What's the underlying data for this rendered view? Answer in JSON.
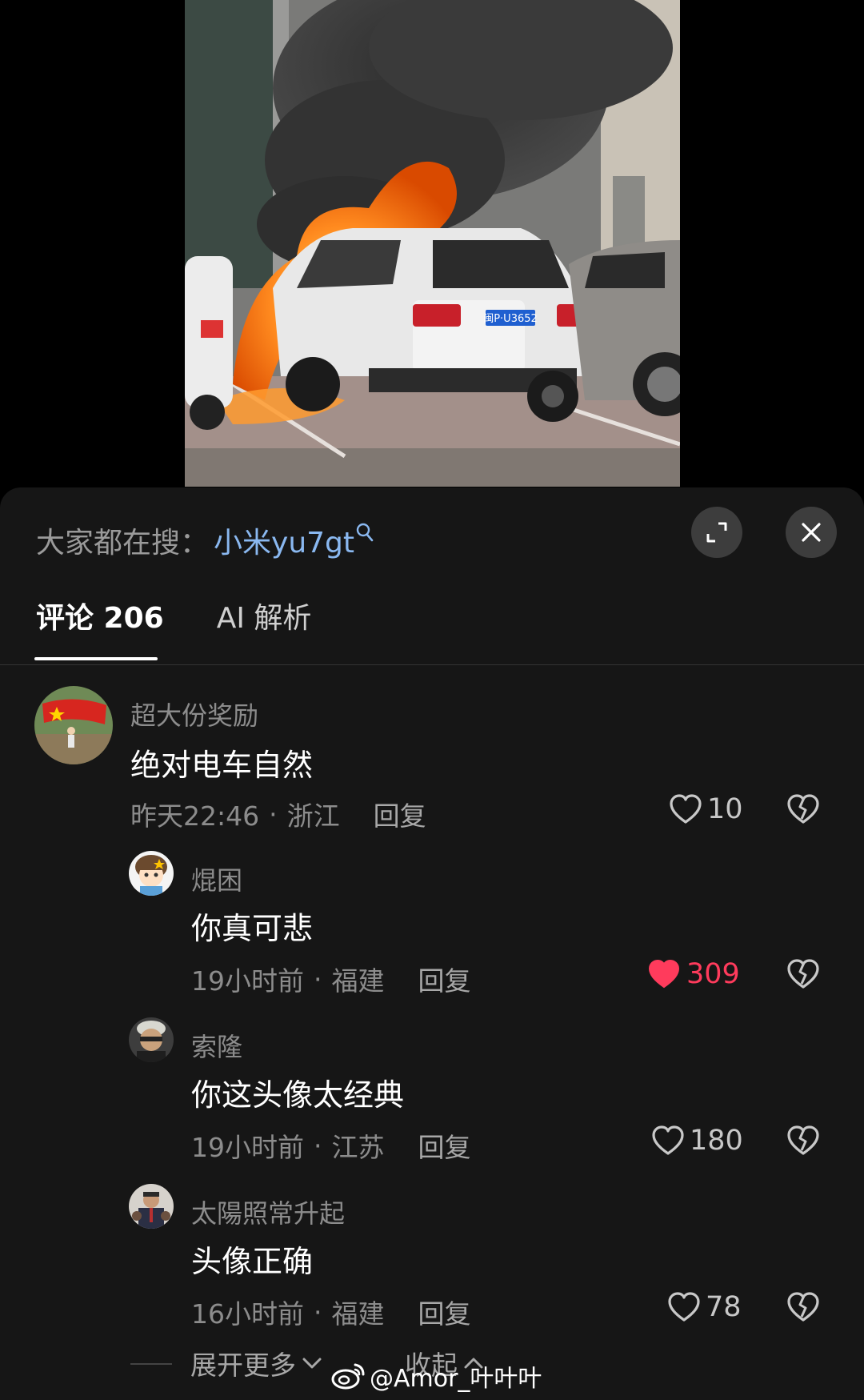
{
  "search": {
    "prefix": "大家都在搜：",
    "term": "小米yu7gt",
    "icon": "search-icon"
  },
  "tabs": [
    {
      "label": "评论 206",
      "active": true
    },
    {
      "label": "AI 解析",
      "active": false
    }
  ],
  "video": {
    "plate": "闽P·U3652"
  },
  "comments": [
    {
      "name": "超大份奖励",
      "text": "绝对电车自然",
      "time": "昨天22:46",
      "location": "浙江",
      "reply": "回复",
      "likes": "10",
      "liked": false
    },
    {
      "name": "焜困",
      "text": "你真可悲",
      "time": "19小时前",
      "location": "福建",
      "reply": "回复",
      "likes": "309",
      "liked": true
    },
    {
      "name": "索隆",
      "text": "你这头像太经典",
      "time": "19小时前",
      "location": "江苏",
      "reply": "回复",
      "likes": "180",
      "liked": false
    },
    {
      "name": "太陽照常升起",
      "text": "头像正确",
      "time": "16小时前",
      "location": "福建",
      "reply": "回复",
      "likes": "78",
      "liked": false
    }
  ],
  "footer": {
    "expand_more": "展开更多",
    "collapse": "收起",
    "watermark": "@Amor_叶叶叶"
  },
  "colors": {
    "accent_link": "#8ab8f0",
    "liked_red": "#ff3b5c",
    "panel_bg": "#161616"
  }
}
